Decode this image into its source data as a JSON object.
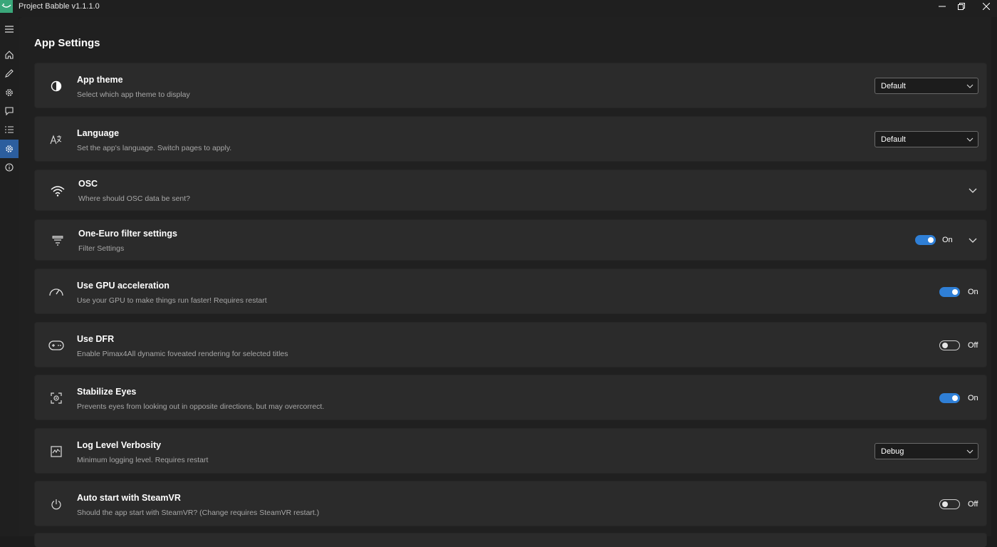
{
  "window": {
    "title": "Project Babble v1.1.1.0"
  },
  "sidebar": {
    "items": [
      {
        "icon": "hamburger-menu-icon"
      },
      {
        "icon": "home-icon"
      },
      {
        "icon": "pencil-icon"
      },
      {
        "icon": "gear-icon"
      },
      {
        "icon": "chat-bubble-icon"
      },
      {
        "icon": "list-icon"
      },
      {
        "icon": "settings-gear-icon",
        "active": true
      },
      {
        "icon": "info-icon"
      }
    ]
  },
  "page": {
    "title": "App Settings"
  },
  "settings": [
    {
      "title": "App theme",
      "desc": "Select which app theme to display",
      "icon": "contrast-icon",
      "control": "dropdown",
      "value": "Default"
    },
    {
      "title": "Language",
      "desc": "Set the app's language. Switch pages to apply.",
      "icon": "translate-icon",
      "control": "dropdown",
      "value": "Default"
    },
    {
      "title": "OSC",
      "desc": "Where should OSC data be sent?",
      "icon": "wifi-icon",
      "control": "expander"
    },
    {
      "title": "One-Euro filter settings",
      "desc": "Filter Settings",
      "icon": "filter-icon",
      "control": "toggle-expander",
      "state": "On"
    },
    {
      "title": "Use GPU acceleration",
      "desc": "Use your GPU to make things run faster! Requires restart",
      "icon": "speedometer-icon",
      "control": "toggle",
      "state": "On"
    },
    {
      "title": "Use DFR",
      "desc": "Enable Pimax4All dynamic foveated rendering for selected titles",
      "icon": "gamepad-icon",
      "control": "toggle",
      "state": "Off"
    },
    {
      "title": "Stabilize Eyes",
      "desc": "Prevents eyes from looking out in opposite directions, but may overcorrect.",
      "icon": "eye-scan-icon",
      "control": "toggle",
      "state": "On"
    },
    {
      "title": "Log Level Verbosity",
      "desc": "Minimum logging level. Requires restart",
      "icon": "activity-chart-icon",
      "control": "dropdown",
      "value": "Debug"
    },
    {
      "title": "Auto start with SteamVR",
      "desc": "Should the app start with SteamVR? (Change requires SteamVR restart.)",
      "icon": "power-icon",
      "control": "toggle",
      "state": "Off"
    }
  ],
  "colors": {
    "accent": "#2f7fd6",
    "card": "#2b2b2b",
    "background": "#202020",
    "app_icon": "#3aa77a"
  }
}
